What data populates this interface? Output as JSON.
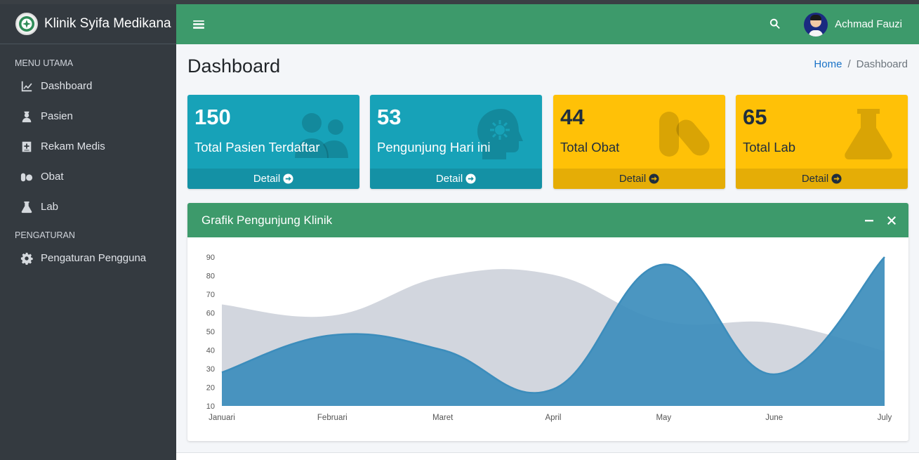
{
  "brand": {
    "name": "Klinik Syifa Medikana"
  },
  "sidebar": {
    "headers": [
      "MENU UTAMA",
      "PENGATURAN"
    ],
    "main_items": [
      {
        "label": "Dashboard",
        "icon": "chart-line-icon"
      },
      {
        "label": "Pasien",
        "icon": "user-nurse-icon"
      },
      {
        "label": "Rekam Medis",
        "icon": "medical-record-icon"
      },
      {
        "label": "Obat",
        "icon": "pills-icon"
      },
      {
        "label": "Lab",
        "icon": "flask-icon"
      }
    ],
    "settings_items": [
      {
        "label": "Pengaturan Pengguna",
        "icon": "gear-icon"
      }
    ]
  },
  "topbar": {
    "user_name": "Achmad Fauzi"
  },
  "page": {
    "title": "Dashboard",
    "breadcrumb": {
      "home": "Home",
      "separator": "/",
      "current": "Dashboard"
    }
  },
  "stats": [
    {
      "value": "150",
      "label": "Total Pasien Terdaftar",
      "footer": "Detail",
      "color": "#17a2b8",
      "icon": "users-icon"
    },
    {
      "value": "53",
      "label": "Pengunjung Hari ini",
      "footer": "Detail",
      "color": "#17a2b8",
      "icon": "head-virus-icon"
    },
    {
      "value": "44",
      "label": "Total Obat",
      "footer": "Detail",
      "color": "#ffc107",
      "icon": "pills-icon"
    },
    {
      "value": "65",
      "label": "Total Lab",
      "footer": "Detail",
      "color": "#ffc107",
      "icon": "flask-icon"
    }
  ],
  "chart_card": {
    "title": "Grafik Pengunjung Klinik"
  },
  "chart_data": {
    "type": "area",
    "categories": [
      "Januari",
      "Februari",
      "Maret",
      "April",
      "May",
      "June",
      "July"
    ],
    "ylim": [
      10,
      90
    ],
    "yticks": [
      10,
      20,
      30,
      40,
      50,
      60,
      70,
      80,
      90
    ],
    "grid": false,
    "series": [
      {
        "values": [
          65,
          59,
          80,
          81,
          56,
          55,
          40
        ],
        "color": "#d2d6de",
        "stroke": "#ffffff"
      },
      {
        "values": [
          28,
          48,
          40,
          19,
          86,
          27,
          90
        ],
        "color": "#3c8dbc",
        "stroke": "#3c8dbc"
      }
    ]
  }
}
